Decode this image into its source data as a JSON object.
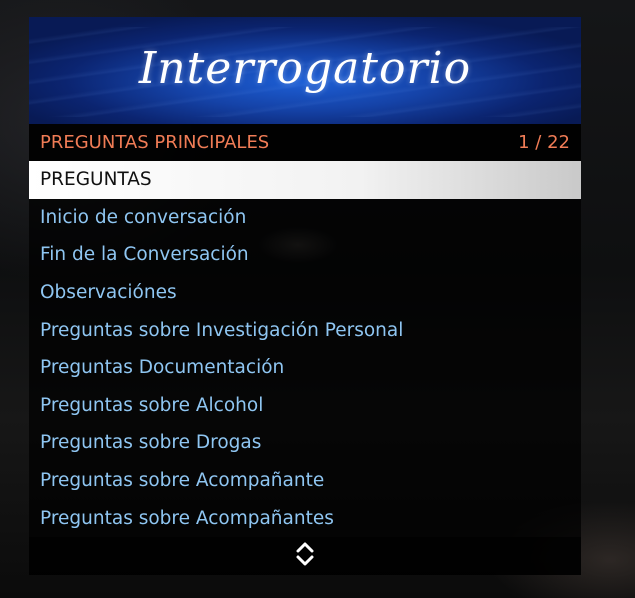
{
  "banner": {
    "title": "Interrogatorio"
  },
  "subheader": {
    "title": "PREGUNTAS PRINCIPALES",
    "counter": "1 / 22"
  },
  "items": [
    {
      "label": "PREGUNTAS"
    },
    {
      "label": "Inicio de conversación"
    },
    {
      "label": "Fin de la Conversación"
    },
    {
      "label": "Observaciónes"
    },
    {
      "label": "Preguntas sobre Investigación Personal"
    },
    {
      "label": "Preguntas Documentación"
    },
    {
      "label": "Preguntas sobre Alcohol"
    },
    {
      "label": "Preguntas sobre Drogas"
    },
    {
      "label": "Preguntas sobre Acompañante"
    },
    {
      "label": "Preguntas sobre Acompañantes"
    }
  ],
  "footer": {
    "icon": "up-down-arrows-icon"
  },
  "colors": {
    "banner_blue": "#1543a8",
    "subheader_text": "#f07c56",
    "item_text": "#8fc6f2",
    "selected_bg": "#ffffff",
    "selected_text": "#111111"
  }
}
